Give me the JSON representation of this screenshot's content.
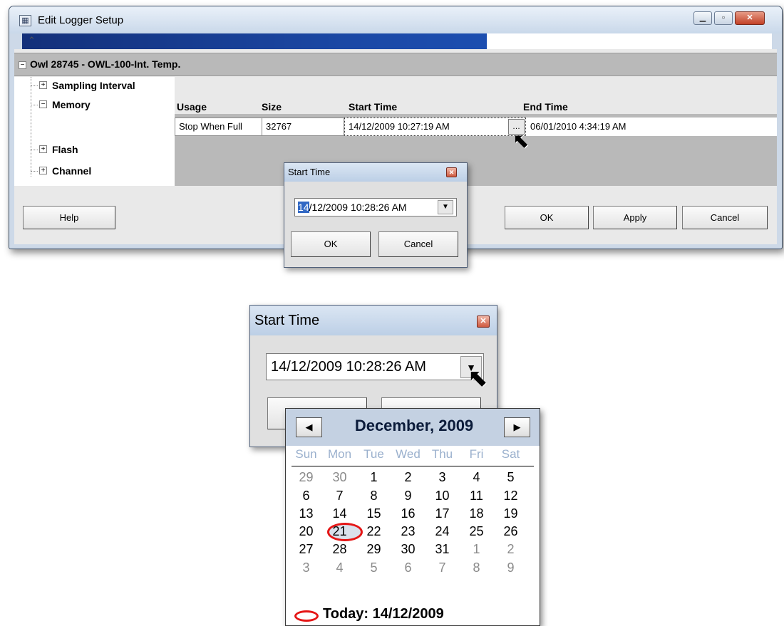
{
  "main_window": {
    "title": "Edit Logger Setup",
    "title_icon": "logger-app-icon",
    "window_controls": [
      "minimize",
      "maximize",
      "close"
    ],
    "device": {
      "label": "Owl 28745 - OWL-100-Int. Temp.",
      "tree": [
        {
          "label": "Sampling Interval",
          "expanded": false
        },
        {
          "label": "Memory",
          "expanded": true
        },
        {
          "label": "Flash",
          "expanded": false
        },
        {
          "label": "Channel",
          "expanded": false
        }
      ]
    },
    "memory": {
      "headers": {
        "usage": "Usage",
        "size": "Size",
        "start_time": "Start Time",
        "end_time": "End Time"
      },
      "values": {
        "usage": "Stop When Full",
        "size": "32767",
        "start_time": "14/12/2009 10:27:19 AM",
        "end_time": "06/01/2010 4:34:19 AM"
      }
    },
    "buttons": {
      "help": "Help",
      "ok": "OK",
      "apply": "Apply",
      "cancel": "Cancel"
    },
    "progress_fill": 0.62
  },
  "start_time_dialog": {
    "title": "Start Time",
    "value_day": "14",
    "value_rest": "/12/2009 10:28:26 AM",
    "ok_label": "OK",
    "cancel_label": "Cancel"
  },
  "start_time_dialog_zoom": {
    "title": "Start Time",
    "value": "14/12/2009 10:28:26 AM"
  },
  "calendar": {
    "month_label": "December, 2009",
    "weekdays": [
      "Sun",
      "Mon",
      "Tue",
      "Wed",
      "Thu",
      "Fri",
      "Sat"
    ],
    "weeks": [
      [
        "29",
        "30",
        "1",
        "2",
        "3",
        "4",
        "5"
      ],
      [
        "6",
        "7",
        "8",
        "9",
        "10",
        "11",
        "12"
      ],
      [
        "13",
        "14",
        "15",
        "16",
        "17",
        "18",
        "19"
      ],
      [
        "20",
        "21",
        "22",
        "23",
        "24",
        "25",
        "26"
      ],
      [
        "27",
        "28",
        "29",
        "30",
        "31",
        "1",
        "2"
      ],
      [
        "3",
        "4",
        "5",
        "6",
        "7",
        "8",
        "9"
      ]
    ],
    "out_of_month": [
      [
        0,
        0
      ],
      [
        0,
        1
      ],
      [
        4,
        5
      ],
      [
        4,
        6
      ],
      [
        5,
        0
      ],
      [
        5,
        1
      ],
      [
        5,
        2
      ],
      [
        5,
        3
      ],
      [
        5,
        4
      ],
      [
        5,
        5
      ],
      [
        5,
        6
      ]
    ],
    "selected": [
      2,
      1
    ],
    "today_label": "Today: 14/12/2009",
    "highlight_color": "#e51616"
  }
}
